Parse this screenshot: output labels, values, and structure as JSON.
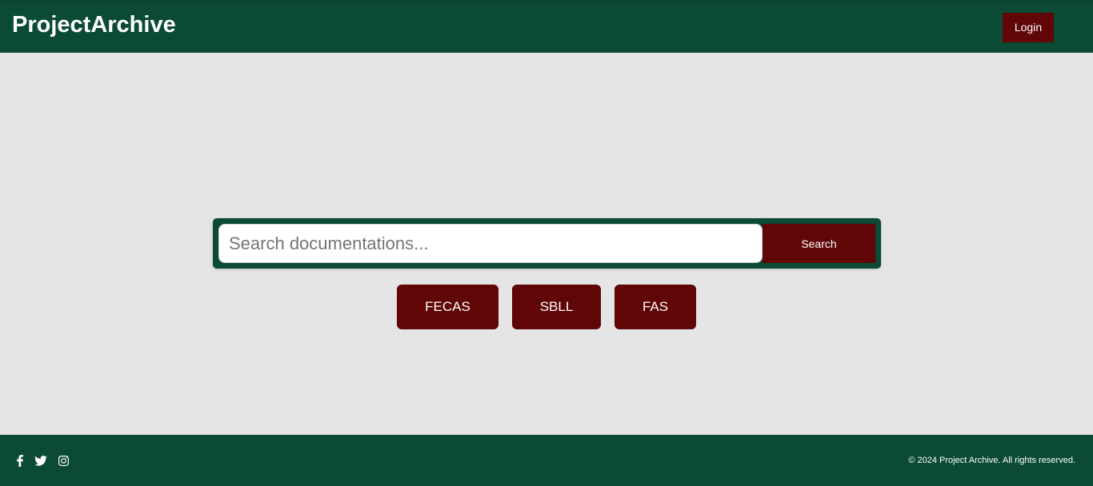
{
  "header": {
    "brand": "ProjectArchive",
    "login_label": "Login"
  },
  "search": {
    "placeholder": "Search documentations...",
    "value": "",
    "button_label": "Search"
  },
  "categories": [
    {
      "label": "FECAS"
    },
    {
      "label": "SBLL"
    },
    {
      "label": "FAS"
    }
  ],
  "footer": {
    "social_icons": [
      "facebook-icon",
      "twitter-icon",
      "instagram-icon"
    ],
    "copyright": "© 2024 Project Archive. All rights reserved."
  },
  "colors": {
    "primary_green": "#0b4a34",
    "accent_maroon": "#600606",
    "background": "#e5e5e5"
  }
}
